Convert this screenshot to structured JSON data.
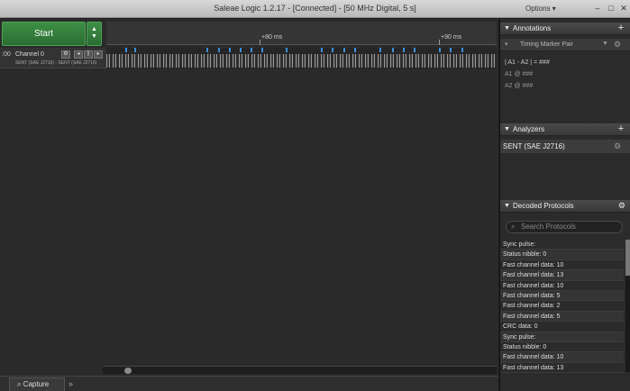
{
  "window": {
    "title": "Saleae Logic 1.2.17 - [Connected] - [50 MHz Digital, 5 s]",
    "options_label": "Options ▾",
    "min_icon": "–",
    "max_icon": "□",
    "close_icon": "✕"
  },
  "toolbar": {
    "start_label": "Start",
    "start_arrows": "▲▼"
  },
  "ruler": {
    "labels": [
      "+80 ms",
      "+90 ms"
    ]
  },
  "channel": {
    "number": ":00",
    "name": "Channel 0",
    "subtitle": "SENT (SAE J2716) - SENT (SAE J2716)",
    "gear_icon": "⚙",
    "left_icon": "◂",
    "ruler_icon": "⫿",
    "right_icon": "▸"
  },
  "bottom": {
    "capture_label": "Capture",
    "more_label": "»"
  },
  "annotations": {
    "title": "Annotations",
    "add": "+",
    "marker_name": "Timing Marker Pair",
    "lines": [
      "| A1 - A2 | = ###",
      "A1  @  ###",
      "A2  @  ###"
    ]
  },
  "analyzers": {
    "title": "Analyzers",
    "add": "+",
    "items": [
      "SENT (SAE J2716)"
    ]
  },
  "decoded": {
    "title": "Decoded Protocols",
    "search_placeholder": "Search Protocols",
    "items": [
      "Sync pulse:",
      "Status nibble: 0",
      "Fast channel data: 10",
      "Fast channel data: 13",
      "Fast channel data: 10",
      "Fast channel data: 5",
      "Fast channel data: 2",
      "Fast channel data: 5",
      "CRC data: 0",
      "Sync pulse:",
      "Status nibble: 0",
      "Fast channel data: 10",
      "Fast channel data: 13"
    ]
  },
  "colors": {
    "start_green": "#3e8f46",
    "marker_blue": "#3a8fd9"
  }
}
